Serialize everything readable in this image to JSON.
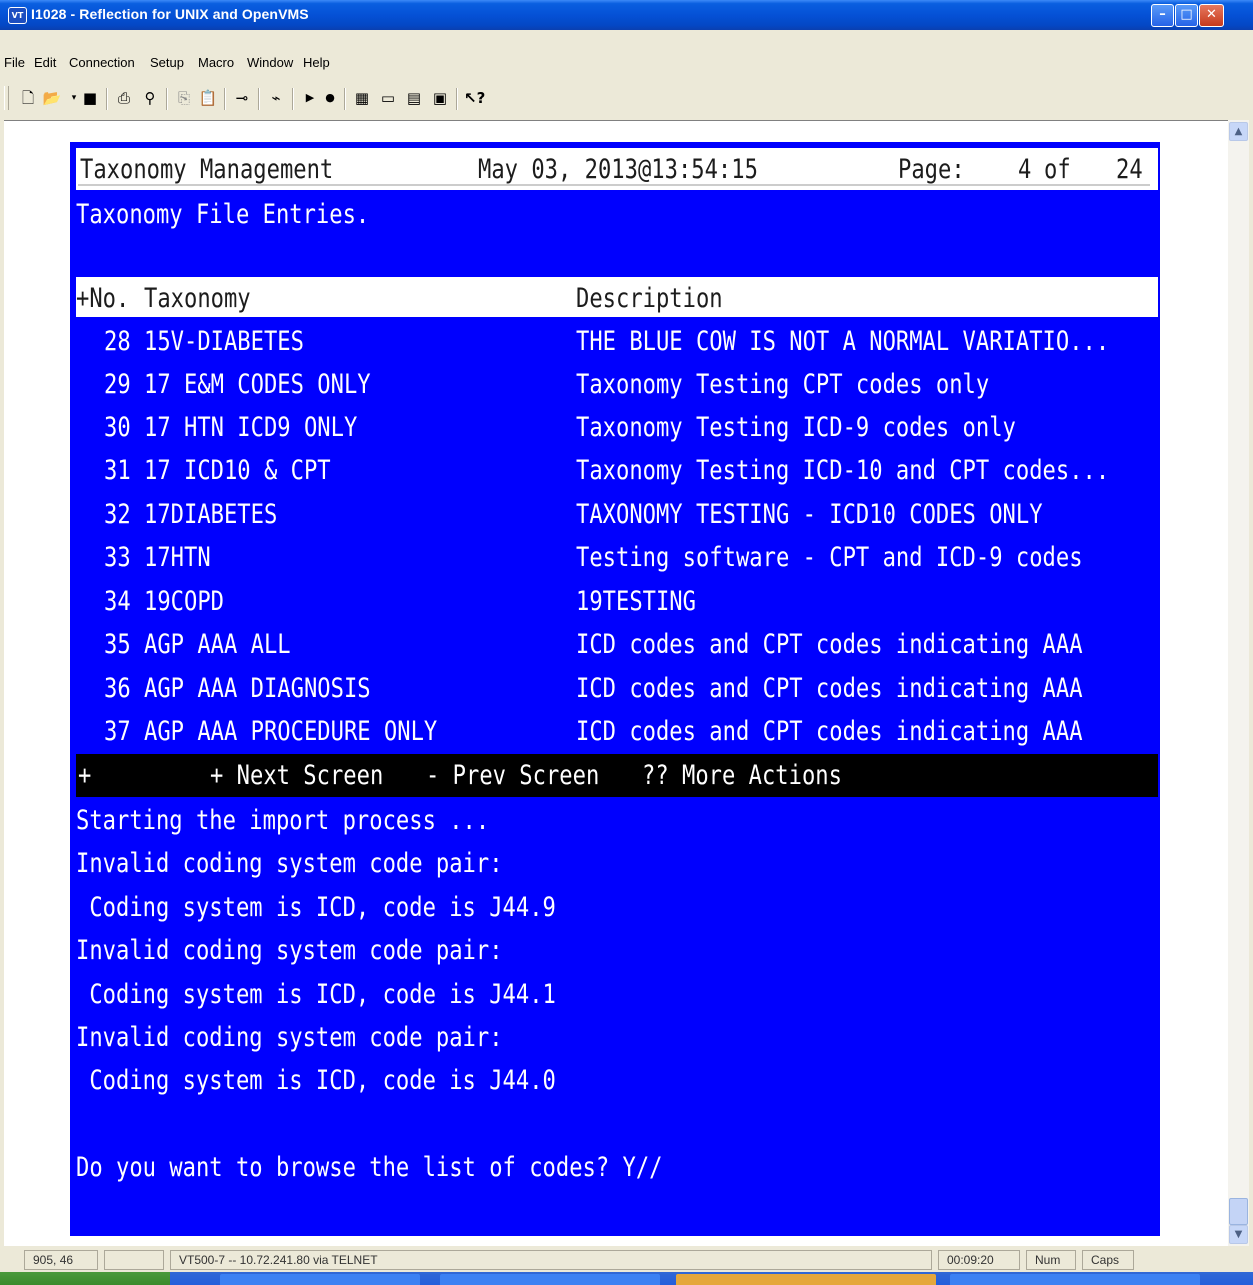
{
  "window": {
    "icon": "VT",
    "title": "I1028 - Reflection for UNIX and OpenVMS",
    "minimize": "–",
    "maximize": "□",
    "close": "✕"
  },
  "menu": [
    "File",
    "Edit",
    "Connection",
    "Setup",
    "Macro",
    "Window",
    "Help"
  ],
  "toolbar_icons": [
    "new-icon",
    "open-icon",
    "save-icon",
    "print-icon",
    "find-icon",
    "copy-icon",
    "paste-icon",
    "connect-icon",
    "disconnect-icon",
    "play-icon",
    "record-icon",
    "settings-icon",
    "display-icon",
    "keyboard-icon",
    "mouse-icon",
    "help-pointer-icon"
  ],
  "terminal": {
    "header": {
      "app": "Taxonomy Management",
      "datetime": "May 03, 2013@13:54:15",
      "page_label": "Page:",
      "page_current": "4",
      "page_of": "of",
      "page_total": "24"
    },
    "subtitle": "Taxonomy File Entries.",
    "columns": {
      "plus_no": "+No.",
      "taxonomy": "Taxonomy",
      "description": "Description"
    },
    "rows": [
      {
        "no": "28",
        "taxonomy": "15V-DIABETES",
        "description": "THE BLUE COW IS NOT A NORMAL VARIATIO..."
      },
      {
        "no": "29",
        "taxonomy": "17 E&M CODES ONLY",
        "description": "Taxonomy Testing CPT codes only"
      },
      {
        "no": "30",
        "taxonomy": "17 HTN ICD9 ONLY",
        "description": "Taxonomy Testing ICD-9 codes only"
      },
      {
        "no": "31",
        "taxonomy": "17 ICD10 & CPT",
        "description": "Taxonomy Testing ICD-10 and CPT codes..."
      },
      {
        "no": "32",
        "taxonomy": "17DIABETES",
        "description": "TAXONOMY TESTING - ICD10 CODES ONLY"
      },
      {
        "no": "33",
        "taxonomy": "17HTN",
        "description": "Testing software - CPT and ICD-9 codes"
      },
      {
        "no": "34",
        "taxonomy": "19COPD",
        "description": "19TESTING"
      },
      {
        "no": "35",
        "taxonomy": "AGP AAA ALL",
        "description": "ICD codes and CPT codes indicating AAA"
      },
      {
        "no": "36",
        "taxonomy": "AGP AAA DIAGNOSIS",
        "description": "ICD codes and CPT codes indicating AAA"
      },
      {
        "no": "37",
        "taxonomy": "AGP AAA PROCEDURE ONLY",
        "description": "ICD codes and CPT codes indicating AAA"
      }
    ],
    "actions": {
      "plus": "+",
      "next": "+ Next Screen",
      "prev": "- Prev Screen",
      "more": "?? More Actions"
    },
    "messages": [
      "Starting the import process ...",
      "Invalid coding system code pair:",
      " Coding system is ICD, code is J44.9",
      "Invalid coding system code pair:",
      " Coding system is ICD, code is J44.1",
      "Invalid coding system code pair:",
      " Coding system is ICD, code is J44.0"
    ],
    "prompt": "Do you want to browse the list of codes? Y//"
  },
  "scrollbar": {
    "up": "▲",
    "down": "▼"
  },
  "statusbar": {
    "position": "905, 46",
    "blank": "",
    "connection": "VT500-7 -- 10.72.241.80 via TELNET",
    "timer": "00:09:20",
    "num": "Num",
    "caps": "Caps"
  }
}
